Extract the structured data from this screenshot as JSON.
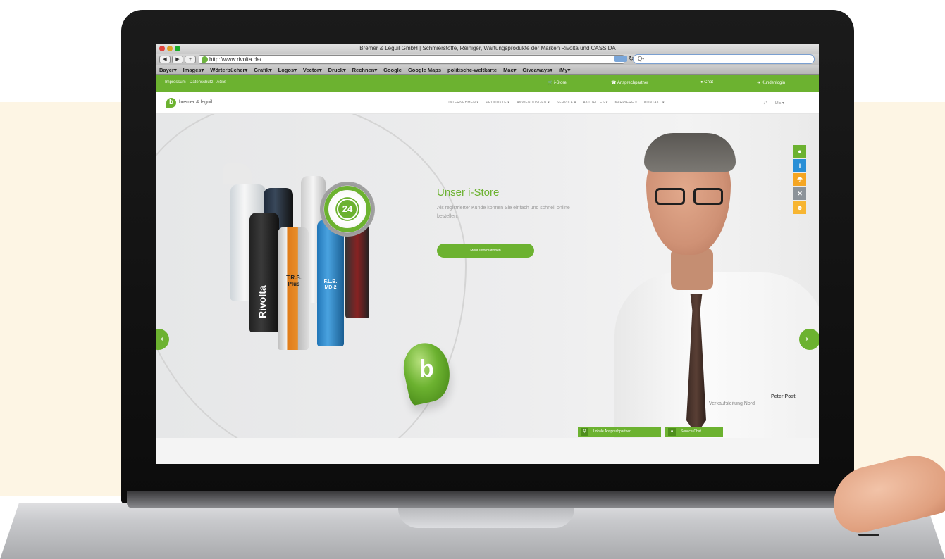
{
  "browser": {
    "window_title": "Bremer & Leguil GmbH | Schmierstoffe, Reiniger, Wartungsprodukte der Marken Rivolta und CASSIDA",
    "url": "http://www.rivolta.de/",
    "search_placeholder": "Q•",
    "bookmarks": [
      "Bayer▾",
      "Images▾",
      "Wörterbücher▾",
      "Grafik▾",
      "Logos▾",
      "Vector▾",
      "Druck▾",
      "Rechnen▾",
      "Google",
      "Google Maps",
      "politische-weltkarte",
      "Mac▾",
      "Giveaways▾",
      "iMy▾"
    ]
  },
  "site": {
    "topbar": {
      "left_links": "Impressum · Datenschutz · AGB",
      "istore": "i-Store",
      "contact_person": "Ansprechpartner",
      "chat": "Chat",
      "customer_login": "Kundenlogin"
    },
    "logo_text": "bremer & leguil",
    "nav": [
      "UNTERNEHMEN ▾",
      "PRODUKTE ▾",
      "ANWENDUNGEN ▾",
      "SERVICE ▾",
      "AKTUELLES ▾",
      "KARRIERE ▾",
      "KONTAKT ▾"
    ],
    "lang": "DE ▾",
    "hero": {
      "title": "Unser i-Store",
      "text": "Als registrierter Kunde können Sie einfach und schnell online bestellen.",
      "button": "Mehr Informationen",
      "badge_number": "24",
      "product_label_1": "T.R.S. Plus",
      "product_label_2": "F.L.B. MD-2",
      "product_brand": "Rivolta",
      "person_name": "Peter Post",
      "person_role": "Verkaufsleitung Nord"
    },
    "side_icons": [
      {
        "icon": "drop-icon",
        "color": "#6cb230",
        "glyph": "●"
      },
      {
        "icon": "info-icon",
        "color": "#2a8fd6",
        "glyph": "i"
      },
      {
        "icon": "umbrella-icon",
        "color": "#f5a623",
        "glyph": "☂"
      },
      {
        "icon": "tools-icon",
        "color": "#8c9399",
        "glyph": "✕"
      },
      {
        "icon": "smile-icon",
        "color": "#f7b531",
        "glyph": "☻"
      }
    ],
    "contact_tabs": {
      "local": "Lokale Ansprechpartner",
      "service_chat": "Service-Chat"
    },
    "arrows": {
      "prev": "‹",
      "next": "›"
    }
  },
  "colors": {
    "brand_green": "#6cb230",
    "background_band": "#fdf5e4"
  }
}
